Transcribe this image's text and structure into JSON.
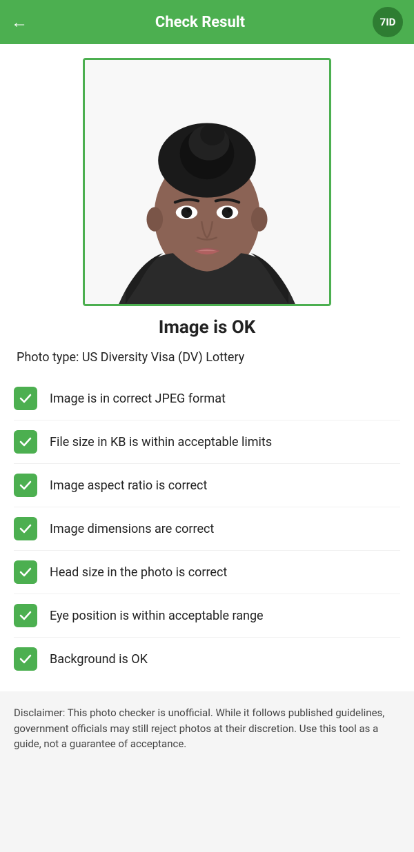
{
  "header": {
    "title": "Check Result",
    "back_icon": "←",
    "logo_text": "7ID"
  },
  "photo": {
    "alt": "Passport photo of a woman"
  },
  "status": {
    "title": "Image is OK"
  },
  "photo_type": {
    "label": "Photo type: US Diversity Visa (DV) Lottery"
  },
  "checks": [
    {
      "id": "jpeg-format",
      "label": "Image is in correct JPEG format",
      "passed": true
    },
    {
      "id": "file-size",
      "label": "File size in KB is within acceptable limits",
      "passed": true
    },
    {
      "id": "aspect-ratio",
      "label": "Image aspect ratio is correct",
      "passed": true
    },
    {
      "id": "dimensions",
      "label": "Image dimensions are correct",
      "passed": true
    },
    {
      "id": "head-size",
      "label": "Head size in the photo is correct",
      "passed": true
    },
    {
      "id": "eye-position",
      "label": "Eye position is within acceptable range",
      "passed": true
    },
    {
      "id": "background",
      "label": "Background is OK",
      "passed": true
    }
  ],
  "disclaimer": {
    "text": "Disclaimer: This photo checker is unofficial. While it follows published guidelines, government officials may still reject photos at their discretion. Use this tool as a guide, not a guarantee of acceptance."
  }
}
